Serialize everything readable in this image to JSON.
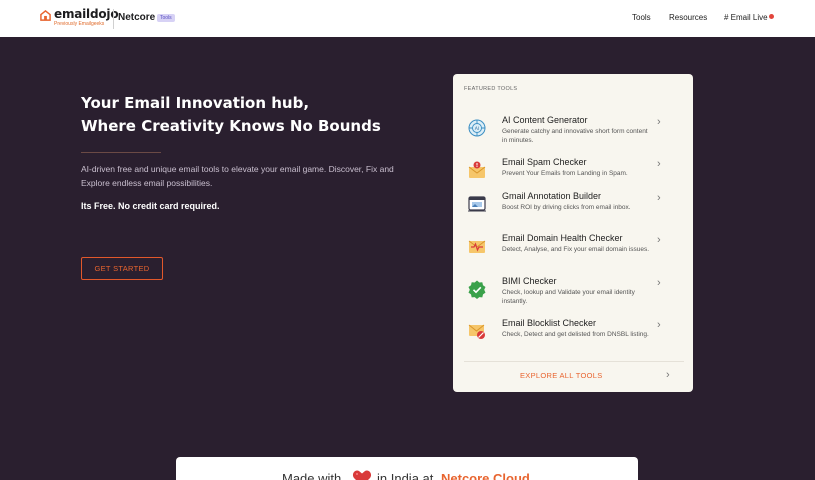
{
  "header": {
    "logo_name": "emaildojo",
    "logo_sub": "Previously Emailgeeks",
    "brand": "Netcore",
    "brand_badge": "Tools",
    "nav": {
      "tools": "Tools",
      "resources": "Resources",
      "live": "# Email Live"
    },
    "accent": "#e8642f",
    "live_dot_color": "#e2453c"
  },
  "hero": {
    "title_line1": "Your Email Innovation hub,",
    "title_line2": "Where Creativity Knows No Bounds",
    "description": "AI-driven free and unique email tools to elevate your email game. Discover, Fix and Explore endless email possibilities.",
    "free_note": "Its Free. No credit card required.",
    "cta": "GET STARTED"
  },
  "featured": {
    "heading": "FEATURED TOOLS",
    "tools": [
      {
        "title": "AI Content Generator",
        "desc": "Generate catchy and innovative short form content in minutes.",
        "icon": "ai-brain-icon"
      },
      {
        "title": "Email Spam Checker",
        "desc": "Prevent Your Emails from Landing in Spam.",
        "icon": "spam-envelope-icon"
      },
      {
        "title": "Gmail Annotation Builder",
        "desc": "Boost ROI by driving clicks from email inbox.",
        "icon": "annotation-window-icon"
      },
      {
        "title": "Email Domain Health Checker",
        "desc": "Detect, Analyse, and Fix your email domain issues.",
        "icon": "health-envelope-icon"
      },
      {
        "title": "BIMI Checker",
        "desc": "Check, lookup and Validate your email identity instantly.",
        "icon": "verified-badge-icon"
      },
      {
        "title": "Email Blocklist Checker",
        "desc": "Check, Detect and get delisted from DNSBL listing.",
        "icon": "blocked-envelope-icon"
      }
    ],
    "explore": "EXPLORE ALL TOOLS"
  },
  "footer": {
    "made_with": "Made with",
    "in_india": "in India at",
    "company": "Netcore Cloud"
  }
}
